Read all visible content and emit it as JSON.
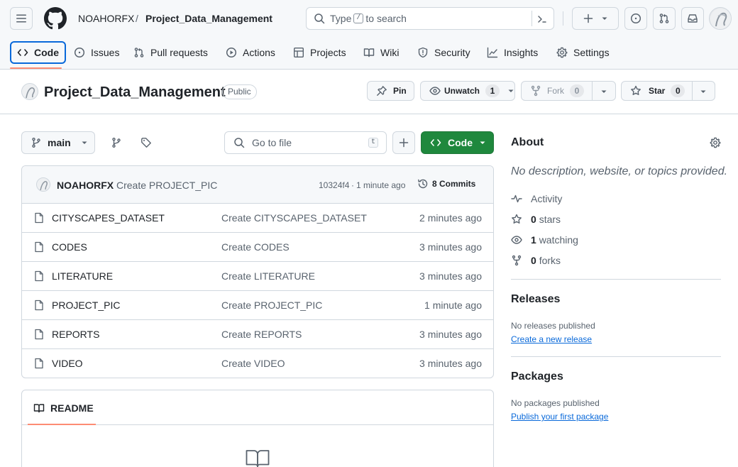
{
  "header": {
    "owner": "NOAHORFX",
    "separator": "/",
    "repo": "Project_Data_Management",
    "search_prefix": "Type",
    "search_key": "/",
    "search_suffix": "to search",
    "plus_icon": "plus-icon"
  },
  "tabs": [
    {
      "label": "Code",
      "icon": "code-icon"
    },
    {
      "label": "Issues",
      "icon": "issue-icon"
    },
    {
      "label": "Pull requests",
      "icon": "pull-request-icon"
    },
    {
      "label": "Actions",
      "icon": "play-icon"
    },
    {
      "label": "Projects",
      "icon": "table-icon"
    },
    {
      "label": "Wiki",
      "icon": "book-icon"
    },
    {
      "label": "Security",
      "icon": "shield-icon"
    },
    {
      "label": "Insights",
      "icon": "graph-icon"
    },
    {
      "label": "Settings",
      "icon": "gear-icon"
    }
  ],
  "repo_header": {
    "title": "Project_Data_Management",
    "visibility": "Public",
    "pin_label": "Pin",
    "watch_label": "Unwatch",
    "watch_count": "1",
    "fork_label": "Fork",
    "fork_count": "0",
    "star_label": "Star",
    "star_count": "0"
  },
  "toolbar": {
    "branch": "main",
    "goto_placeholder": "Go to file",
    "goto_key": "t",
    "code_label": "Code"
  },
  "commit": {
    "author": "NOAHORFX",
    "message": "Create PROJECT_PIC",
    "hash": "10324f4",
    "dot": "·",
    "time": "1 minute ago",
    "commits_label": "8 Commits"
  },
  "files": [
    {
      "name": "CITYSCAPES_DATASET",
      "message": "Create CITYSCAPES_DATASET",
      "time": "2 minutes ago"
    },
    {
      "name": "CODES",
      "message": "Create CODES",
      "time": "3 minutes ago"
    },
    {
      "name": "LITERATURE",
      "message": "Create LITERATURE",
      "time": "3 minutes ago"
    },
    {
      "name": "PROJECT_PIC",
      "message": "Create PROJECT_PIC",
      "time": "1 minute ago"
    },
    {
      "name": "REPORTS",
      "message": "Create REPORTS",
      "time": "3 minutes ago"
    },
    {
      "name": "VIDEO",
      "message": "Create VIDEO",
      "time": "3 minutes ago"
    }
  ],
  "readme": {
    "label": "README"
  },
  "about": {
    "title": "About",
    "description": "No description, website, or topics provided.",
    "activity": "Activity",
    "stars_count": "0",
    "stars_label": "stars",
    "watching_count": "1",
    "watching_label": "watching",
    "forks_count": "0",
    "forks_label": "forks"
  },
  "releases": {
    "title": "Releases",
    "text": "No releases published",
    "link": "Create a new release"
  },
  "packages": {
    "title": "Packages",
    "text": "No packages published",
    "link": "Publish your first package"
  },
  "colors": {
    "accent": "#0969da",
    "primary_button": "#1f883d",
    "tab_underline": "#fd8c73",
    "border": "#d0d7de"
  }
}
